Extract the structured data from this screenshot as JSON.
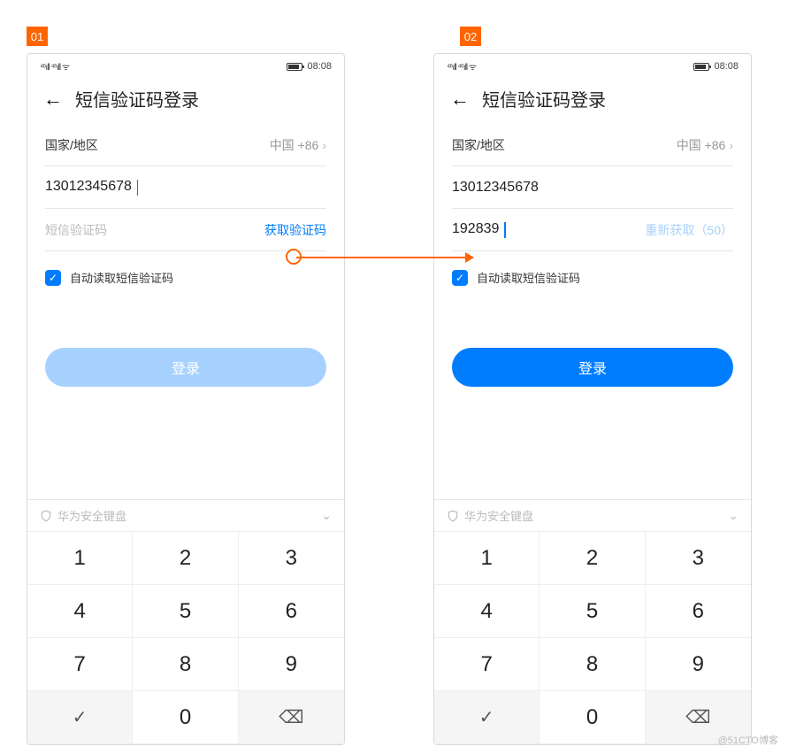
{
  "badges": {
    "left": "01",
    "right": "02"
  },
  "status": {
    "icons": "⁴⁶ıll ⁴⁶ıll ᯤ",
    "time": "08:08"
  },
  "nav": {
    "title": "短信验证码登录"
  },
  "country": {
    "label": "国家/地区",
    "value": "中国 +86"
  },
  "phone": {
    "value": "13012345678"
  },
  "sms": {
    "placeholder": "短信验证码",
    "get_label": "获取验证码",
    "filled_value": "192839",
    "resend_label": "重新获取（50）"
  },
  "autofill": {
    "label": "自动读取短信验证码"
  },
  "login": {
    "label": "登录"
  },
  "keyboard": {
    "secure_label": "华为安全键盘",
    "keys": [
      "1",
      "2",
      "3",
      "4",
      "5",
      "6",
      "7",
      "8",
      "9",
      "✓",
      "0",
      "⌫"
    ]
  },
  "watermark": "@51CTO博客"
}
